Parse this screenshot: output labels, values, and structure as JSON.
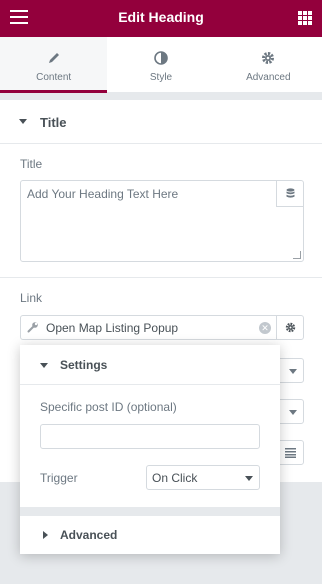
{
  "header": {
    "title": "Edit Heading",
    "menu_icon": "hamburger-menu-icon",
    "grid_icon": "widgets-grid-icon",
    "background": "#93003c"
  },
  "tabs": [
    {
      "label": "Content",
      "icon": "pencil-icon",
      "active": true
    },
    {
      "label": "Style",
      "icon": "contrast-icon",
      "active": false
    },
    {
      "label": "Advanced",
      "icon": "gear-icon",
      "active": false
    }
  ],
  "section": {
    "title": "Title"
  },
  "fields": {
    "title_label": "Title",
    "title_placeholder": "Add Your Heading Text Here",
    "link_label": "Link",
    "link_value": "Open Map Listing Popup"
  },
  "popover": {
    "settings_label": "Settings",
    "post_id_label": "Specific post ID (optional)",
    "post_id_value": "",
    "trigger_label": "Trigger",
    "trigger_value": "On Click",
    "advanced_label": "Advanced"
  },
  "colors": {
    "accent": "#93003c",
    "text": "#6d7882",
    "heading": "#495157",
    "border": "#d5dadf"
  }
}
